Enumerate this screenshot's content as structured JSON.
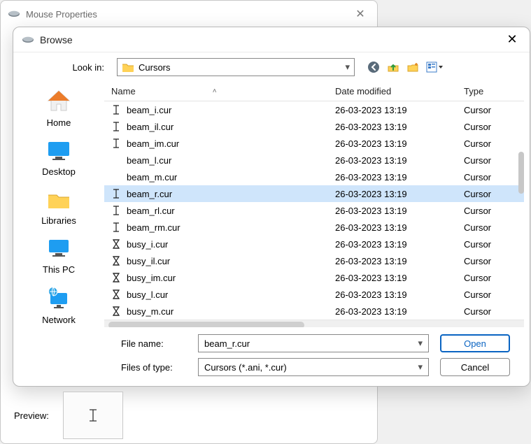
{
  "parent": {
    "title": "Mouse Properties"
  },
  "dialog": {
    "title": "Browse",
    "lookin_label": "Look in:",
    "lookin_value": "Cursors",
    "columns": {
      "name": "Name",
      "date": "Date modified",
      "type": "Type"
    },
    "files": [
      {
        "icon": "ibeam",
        "name": "beam_i.cur",
        "date": "26-03-2023 13:19",
        "type": "Cursor",
        "selected": false
      },
      {
        "icon": "ibeam",
        "name": "beam_il.cur",
        "date": "26-03-2023 13:19",
        "type": "Cursor",
        "selected": false
      },
      {
        "icon": "ibeam",
        "name": "beam_im.cur",
        "date": "26-03-2023 13:19",
        "type": "Cursor",
        "selected": false
      },
      {
        "icon": "",
        "name": "beam_l.cur",
        "date": "26-03-2023 13:19",
        "type": "Cursor",
        "selected": false
      },
      {
        "icon": "",
        "name": "beam_m.cur",
        "date": "26-03-2023 13:19",
        "type": "Cursor",
        "selected": false
      },
      {
        "icon": "ibeam",
        "name": "beam_r.cur",
        "date": "26-03-2023 13:19",
        "type": "Cursor",
        "selected": true
      },
      {
        "icon": "ibeam",
        "name": "beam_rl.cur",
        "date": "26-03-2023 13:19",
        "type": "Cursor",
        "selected": false
      },
      {
        "icon": "ibeam",
        "name": "beam_rm.cur",
        "date": "26-03-2023 13:19",
        "type": "Cursor",
        "selected": false
      },
      {
        "icon": "hour",
        "name": "busy_i.cur",
        "date": "26-03-2023 13:19",
        "type": "Cursor",
        "selected": false
      },
      {
        "icon": "hour",
        "name": "busy_il.cur",
        "date": "26-03-2023 13:19",
        "type": "Cursor",
        "selected": false
      },
      {
        "icon": "hour",
        "name": "busy_im.cur",
        "date": "26-03-2023 13:19",
        "type": "Cursor",
        "selected": false
      },
      {
        "icon": "hour",
        "name": "busy_l.cur",
        "date": "26-03-2023 13:19",
        "type": "Cursor",
        "selected": false
      },
      {
        "icon": "hour",
        "name": "busy_m.cur",
        "date": "26-03-2023 13:19",
        "type": "Cursor",
        "selected": false
      }
    ],
    "filename_label": "File name:",
    "filename_value": "beam_r.cur",
    "filetype_label": "Files of type:",
    "filetype_value": "Cursors (*.ani, *.cur)",
    "open_label": "Open",
    "cancel_label": "Cancel",
    "places": [
      {
        "id": "home",
        "label": "Home"
      },
      {
        "id": "desktop",
        "label": "Desktop"
      },
      {
        "id": "libraries",
        "label": "Libraries"
      },
      {
        "id": "thispc",
        "label": "This PC"
      },
      {
        "id": "network",
        "label": "Network"
      }
    ]
  },
  "preview": {
    "label": "Preview:"
  },
  "icons": {
    "back": "back-icon",
    "up": "up-icon",
    "newfolder": "new-folder-icon",
    "viewmenu": "view-menu-icon"
  }
}
